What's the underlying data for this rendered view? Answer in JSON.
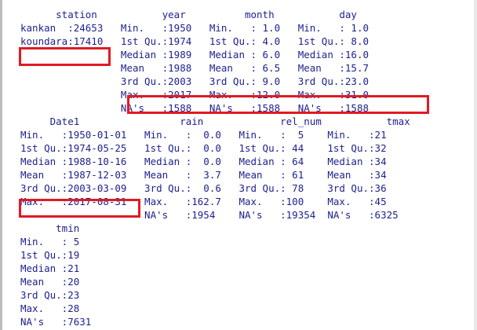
{
  "summary_output": {
    "block1": {
      "header": "      station           year          month           day",
      "rows": [
        "kankan  :24653   Min.   :1950   Min.   : 1.0   Min.   : 1.0",
        "koundara:17410   1st Qu.:1974   1st Qu.: 4.0   1st Qu.: 8.0",
        "                 Median :1989   Median : 6.0   Median :16.0",
        "                 Mean   :1988   Mean   : 6.5   Mean   :15.7",
        "                 3rd Qu.:2003   3rd Qu.: 9.0   3rd Qu.:23.0",
        "                 Max.   :2017   Max.   :12.0   Max.   :31.0",
        "                 NA's   :1588   NA's   :1588   NA's   :1588"
      ]
    },
    "block2": {
      "header": "     Date1                 rain             rel_num           tmax",
      "rows": [
        "Min.   :1950-01-01   Min.   :  0.0   Min.   :  5    Min.   :21",
        "1st Qu.:1974-05-25   1st Qu.:  0.0   1st Qu.: 44    1st Qu.:32",
        "Median :1988-10-16   Median :  0.0   Median : 64    Median :34",
        "Mean   :1987-12-03   Mean   :  3.7   Mean   : 61    Mean   :34",
        "3rd Qu.:2003-03-09   3rd Qu.:  0.6   3rd Qu.: 78    3rd Qu.:36",
        "Max.   :2017-08-31   Max.   :162.7   Max.   :100    Max.   :45",
        "                     NA's   :1954    NA's   :19354  NA's   :6325"
      ]
    },
    "block3": {
      "header": "      tmin",
      "rows": [
        "Min.   : 5",
        "1st Qu.:19",
        "Median :21",
        "Mean   :20",
        "3rd Qu.:23",
        "Max.   :28",
        "NA's   :7631"
      ]
    }
  },
  "colors": {
    "text": "#1c1f8c",
    "highlight": "#e11a22",
    "background": "#ffffff"
  }
}
